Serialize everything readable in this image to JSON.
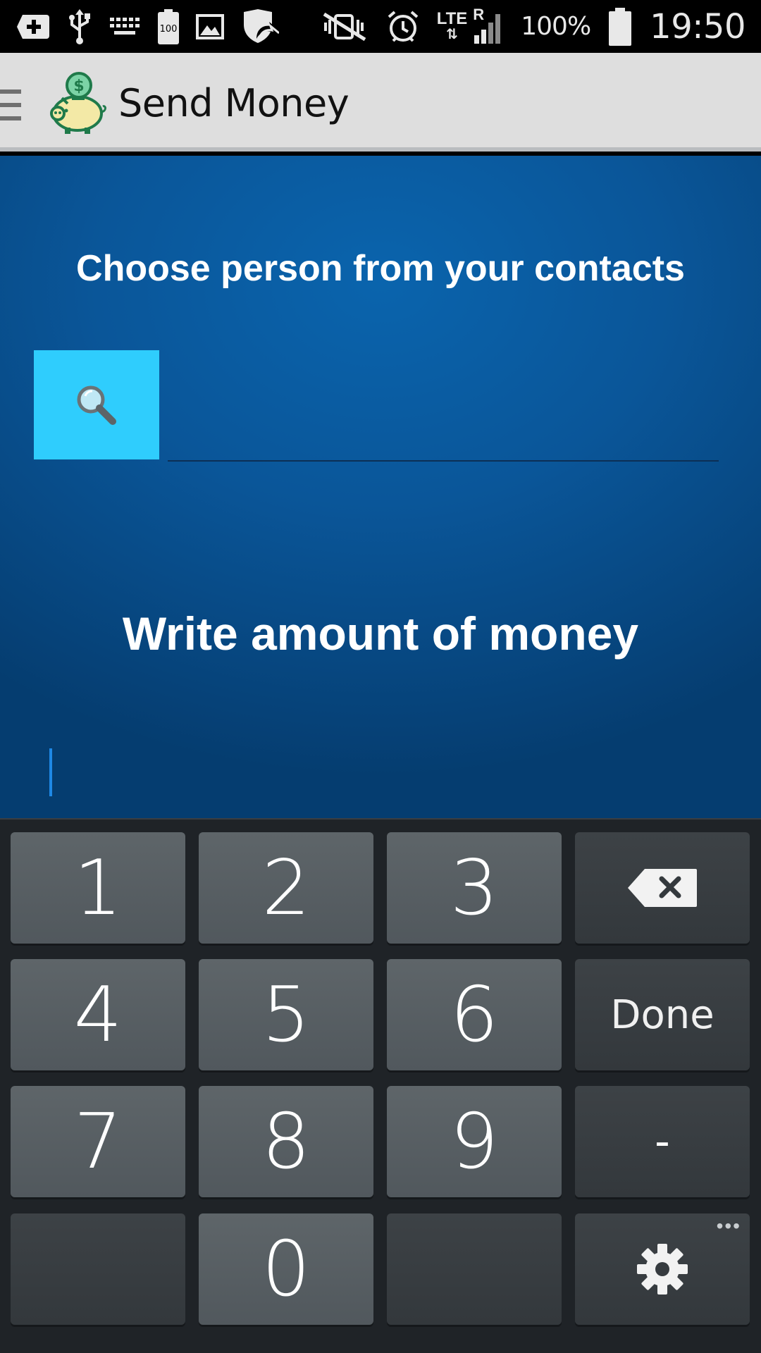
{
  "status_bar": {
    "icons_left": [
      "add-box-icon",
      "usb-icon",
      "keyboard-icon",
      "battery-100-icon",
      "image-icon",
      "shield-sync-icon"
    ],
    "battery_small_label": "100",
    "icons_right": [
      "vibrate-mute-icon",
      "alarm-icon",
      "signal-icon",
      "battery-icon"
    ],
    "network_type": "LTE",
    "roaming": "R",
    "battery_percent": "100%",
    "time": "19:50"
  },
  "action_bar": {
    "title": "Send Money",
    "logo_icon": "piggy-bank-dollar-icon"
  },
  "main": {
    "contacts_heading": "Choose person from your contacts",
    "contact_input_value": "",
    "search_button_icon": "search-icon",
    "amount_heading": "Write amount of money",
    "amount_value": ""
  },
  "keyboard": {
    "keys": {
      "k1": "1",
      "k2": "2",
      "k3": "3",
      "k4": "4",
      "k5": "5",
      "k6": "6",
      "k7": "7",
      "k8": "8",
      "k9": "9",
      "k0": "0",
      "done": "Done",
      "minus": "-",
      "more": "•••"
    }
  },
  "colors": {
    "accent": "#2fcdfd",
    "main_bg": "#0a5699",
    "action_bar_bg": "#dedede",
    "keyboard_bg": "#1f2327"
  }
}
